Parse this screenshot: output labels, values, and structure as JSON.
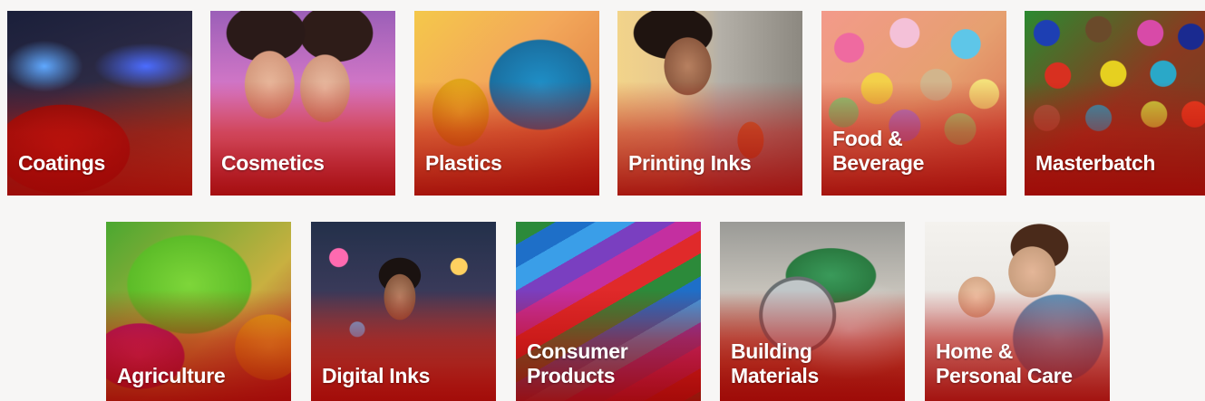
{
  "tiles_row1": [
    {
      "label": "Coatings"
    },
    {
      "label": "Cosmetics"
    },
    {
      "label": "Plastics"
    },
    {
      "label": "Printing Inks"
    },
    {
      "label": "Food & Beverage"
    },
    {
      "label": "Masterbatch"
    }
  ],
  "tiles_row2": [
    {
      "label_lines": [
        "Agriculture"
      ]
    },
    {
      "label_lines": [
        "Digital Inks"
      ]
    },
    {
      "label_lines": [
        "Consumer",
        "Products"
      ]
    },
    {
      "label_lines": [
        "Building",
        "Materials"
      ]
    },
    {
      "label_lines": [
        "Home &",
        "Personal Care"
      ]
    }
  ],
  "colors": {
    "overlay_red": "#b00e0a",
    "label_text": "#ffffff",
    "page_background": "#f7f6f5"
  }
}
